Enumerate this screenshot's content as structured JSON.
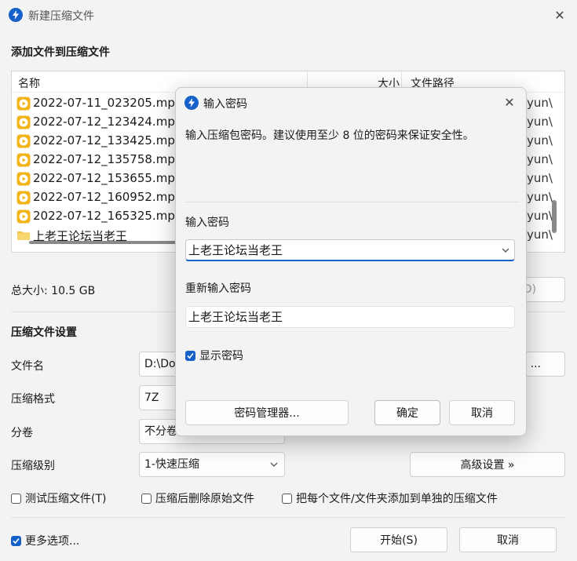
{
  "window": {
    "title": "新建压缩文件"
  },
  "add_section": {
    "title": "添加文件到压缩文件"
  },
  "file_list": {
    "columns": {
      "name": "名称",
      "size": "大小",
      "path": "文件路径"
    },
    "rows": [
      {
        "name": "2022-07-11_023205.mp4",
        "type": "video",
        "path": "yun\\"
      },
      {
        "name": "2022-07-12_123424.mp4",
        "type": "video",
        "path": "yun\\"
      },
      {
        "name": "2022-07-12_133425.mp4",
        "type": "video",
        "path": "yun\\"
      },
      {
        "name": "2022-07-12_135758.mp4",
        "type": "video",
        "path": "yun\\"
      },
      {
        "name": "2022-07-12_153655.mp4",
        "type": "video",
        "path": "yun\\"
      },
      {
        "name": "2022-07-12_160952.mp4",
        "type": "video",
        "path": "yun\\"
      },
      {
        "name": "2022-07-12_165325.mp4",
        "type": "video",
        "path": "yun\\"
      },
      {
        "name": "上老王论坛当老王",
        "type": "folder",
        "path": "yun\\"
      }
    ]
  },
  "total_size": "总大小: 10.5 GB",
  "hidden_button_fragment": "D)",
  "settings": {
    "title": "压缩文件设置",
    "filename_label": "文件名",
    "filename_value": "D:\\Do",
    "browse_fragment": "...",
    "format_label": "压缩格式",
    "format_value": "7Z",
    "split_label": "分卷",
    "split_value": "不分卷",
    "level_label": "压缩级别",
    "level_value": "1-快速压缩",
    "advanced_button": "高级设置 »"
  },
  "options": {
    "test": "测试压缩文件(T)",
    "delete": "压缩后删除原始文件",
    "separate": "把每个文件/文件夹添加到单独的压缩文件",
    "more": "更多选项..."
  },
  "footer": {
    "start": "开始(S)",
    "cancel": "取消"
  },
  "dialog": {
    "title": "输入密码",
    "hint": "输入压缩包密码。建议使用至少 8 位的密码来保证安全性。",
    "password_label": "输入密码",
    "password_value": "上老王论坛当老王",
    "reenter_label": "重新输入密码",
    "reenter_value": "上老王论坛当老王",
    "show_password": "显示密码",
    "manager_button": "密码管理器...",
    "ok_button": "确定",
    "cancel_button": "取消"
  },
  "colors": {
    "accent": "#1560c9",
    "video_icon": "#f2b418",
    "folder_icon": "#f4c542"
  }
}
